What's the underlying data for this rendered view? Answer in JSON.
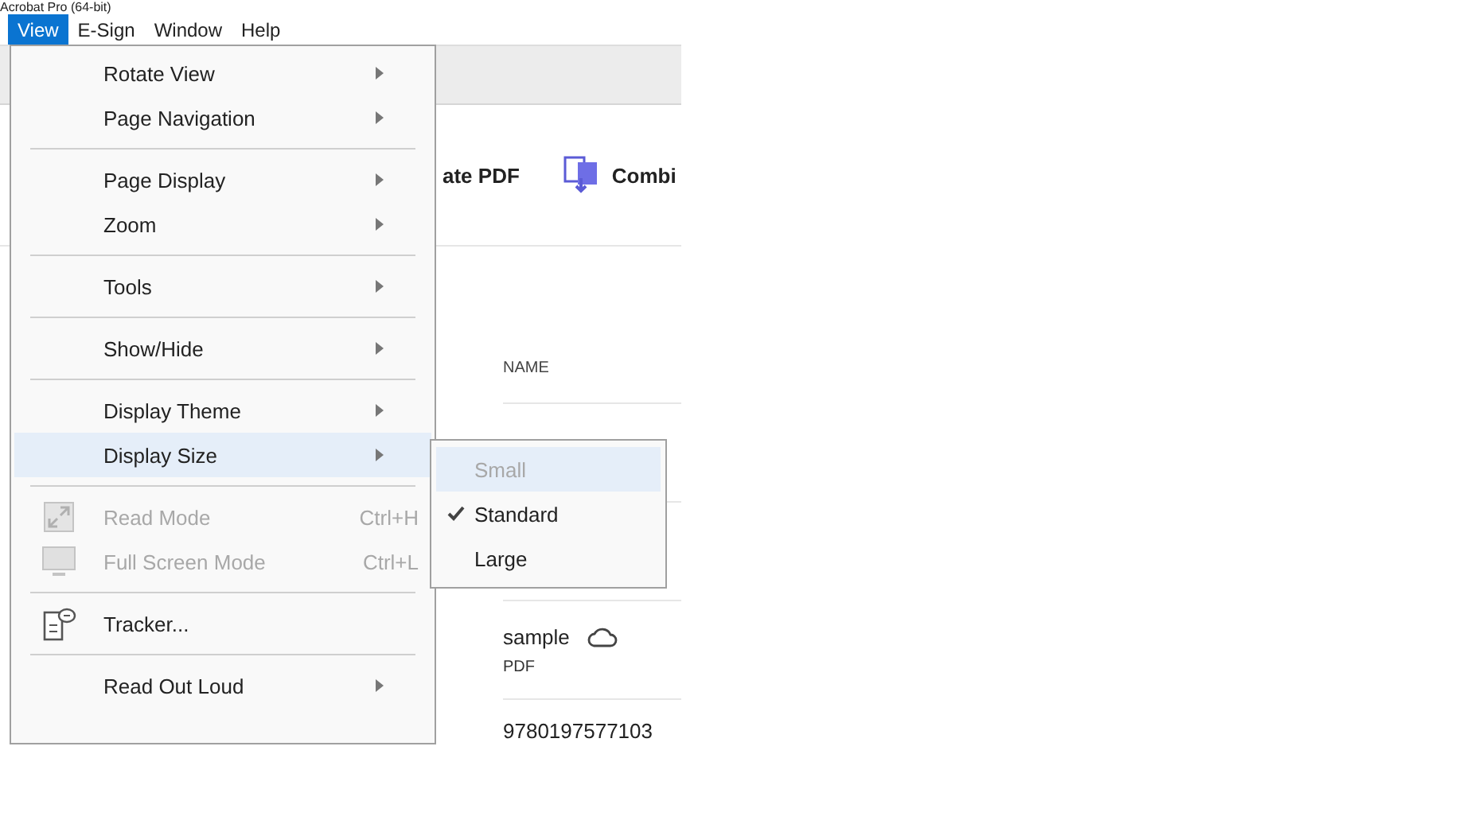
{
  "window": {
    "title": "Acrobat Pro (64-bit)"
  },
  "menubar": [
    {
      "label": "View",
      "selected": true
    },
    {
      "label": "E-Sign",
      "selected": false
    },
    {
      "label": "Window",
      "selected": false
    },
    {
      "label": "Help",
      "selected": false
    }
  ],
  "background": {
    "toolbar_fragments": [
      "ate PDF",
      "Combi"
    ],
    "table": {
      "column": "NAME",
      "rows": [
        {
          "name": "sample",
          "type": "PDF",
          "cloud": true
        },
        {
          "name": "9780197577103"
        }
      ]
    }
  },
  "menu": [
    {
      "kind": "item",
      "label": "Rotate View",
      "submenu": true,
      "disabled": false,
      "selected": false
    },
    {
      "kind": "item",
      "label": "Page Navigation",
      "submenu": true,
      "disabled": false,
      "selected": false
    },
    {
      "kind": "separator"
    },
    {
      "kind": "item",
      "label": "Page Display",
      "submenu": true,
      "disabled": false,
      "selected": false
    },
    {
      "kind": "item",
      "label": "Zoom",
      "submenu": true,
      "disabled": false,
      "selected": false
    },
    {
      "kind": "separator"
    },
    {
      "kind": "item",
      "label": "Tools",
      "submenu": true,
      "disabled": false,
      "selected": false
    },
    {
      "kind": "separator"
    },
    {
      "kind": "item",
      "label": "Show/Hide",
      "submenu": true,
      "disabled": false,
      "selected": false
    },
    {
      "kind": "separator"
    },
    {
      "kind": "item",
      "label": "Display Theme",
      "submenu": true,
      "disabled": false,
      "selected": false
    },
    {
      "kind": "item",
      "label": "Display Size",
      "submenu": true,
      "disabled": false,
      "selected": true
    },
    {
      "kind": "separator"
    },
    {
      "kind": "readmode",
      "label": "Read Mode",
      "shortcut": "Ctrl+H",
      "submenu": false,
      "disabled": true,
      "selected": false
    },
    {
      "kind": "fullscreen",
      "label": "Full Screen Mode",
      "shortcut": "Ctrl+L",
      "submenu": false,
      "disabled": true,
      "selected": false
    },
    {
      "kind": "separator"
    },
    {
      "kind": "tracker",
      "label": "Tracker...",
      "submenu": false,
      "disabled": false,
      "selected": false
    },
    {
      "kind": "separator"
    },
    {
      "kind": "item",
      "label": "Read Out Loud",
      "submenu": true,
      "disabled": false,
      "selected": false
    }
  ],
  "submenu": [
    {
      "label": "Small",
      "checked": false,
      "disabled": true,
      "selected": true
    },
    {
      "label": "Standard",
      "checked": true,
      "disabled": false,
      "selected": false
    },
    {
      "label": "Large",
      "checked": false,
      "disabled": false,
      "selected": false
    }
  ]
}
